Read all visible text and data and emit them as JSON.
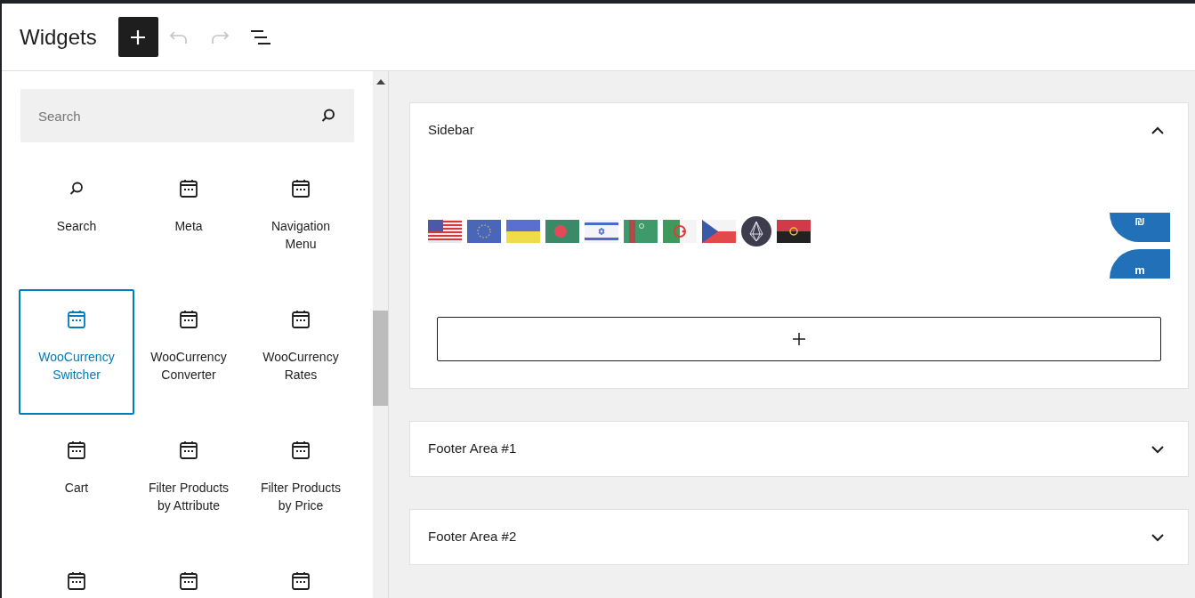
{
  "header": {
    "title": "Widgets",
    "toolbar": [
      {
        "kind": "add",
        "disabled": false
      },
      {
        "kind": "undo",
        "disabled": true
      },
      {
        "kind": "redo",
        "disabled": true
      },
      {
        "kind": "outline",
        "disabled": false
      }
    ]
  },
  "inserter": {
    "search": {
      "placeholder": "Search"
    },
    "blocks": [
      {
        "kind": "search",
        "label": "Search",
        "selected": false
      },
      {
        "kind": "calendar",
        "label": "Meta",
        "selected": false
      },
      {
        "kind": "calendar",
        "label": "Navigation Menu",
        "selected": false
      },
      {
        "kind": "calendar",
        "label": "WooCurrency Switcher",
        "selected": true
      },
      {
        "kind": "calendar",
        "label": "WooCurrency Converter",
        "selected": false
      },
      {
        "kind": "calendar",
        "label": "WooCurrency Rates",
        "selected": false
      },
      {
        "kind": "calendar",
        "label": "Cart",
        "selected": false
      },
      {
        "kind": "calendar",
        "label": "Filter Products by Attribute",
        "selected": false
      },
      {
        "kind": "calendar",
        "label": "Filter Products by Price",
        "selected": false
      },
      {
        "kind": "calendar",
        "selected": false
      },
      {
        "kind": "calendar",
        "selected": false
      },
      {
        "kind": "calendar",
        "selected": false
      }
    ]
  },
  "areas": [
    {
      "title": "Sidebar",
      "expanded": true,
      "flags": [
        {
          "kind": "us"
        },
        {
          "kind": "eu"
        },
        {
          "kind": "ua"
        },
        {
          "kind": "bd"
        },
        {
          "kind": "il"
        },
        {
          "kind": "tm"
        },
        {
          "kind": "dz"
        },
        {
          "kind": "cz"
        },
        {
          "kind": "coin"
        },
        {
          "kind": "ao"
        }
      ],
      "side_tabs": [
        {
          "label": "₪",
          "kind": "cut_top"
        },
        {
          "label": "m",
          "kind": "cut_bottom"
        }
      ]
    },
    {
      "title": "Footer Area #1",
      "expanded": false
    },
    {
      "title": "Footer Area #2",
      "expanded": false
    }
  ]
}
